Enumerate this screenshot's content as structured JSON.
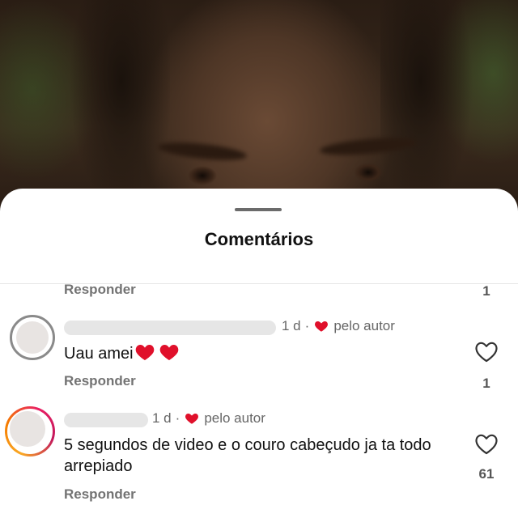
{
  "sheet": {
    "title": "Comentários"
  },
  "previous_comment": {
    "reply_label": "Responder",
    "likes": "1"
  },
  "comments": [
    {
      "time": "1 d",
      "separator": "·",
      "author_badge": "pelo autor",
      "text": "Uau amei",
      "emojis": [
        "red-heart",
        "red-heart"
      ],
      "reply_label": "Responder",
      "likes": "1",
      "avatar_ring": "none"
    },
    {
      "time": "1 d",
      "separator": "·",
      "author_badge": "pelo autor",
      "text": "5 segundos de video e o couro cabeçudo ja ta todo arrepiado",
      "reply_label": "Responder",
      "likes": "61",
      "avatar_ring": "story-gradient"
    }
  ],
  "colors": {
    "heart": "#e0102b",
    "secondary_text": "#737373",
    "primary_text": "#111111"
  },
  "icons": {
    "like": "heart-outline-icon",
    "author_liked": "red-heart-icon"
  }
}
